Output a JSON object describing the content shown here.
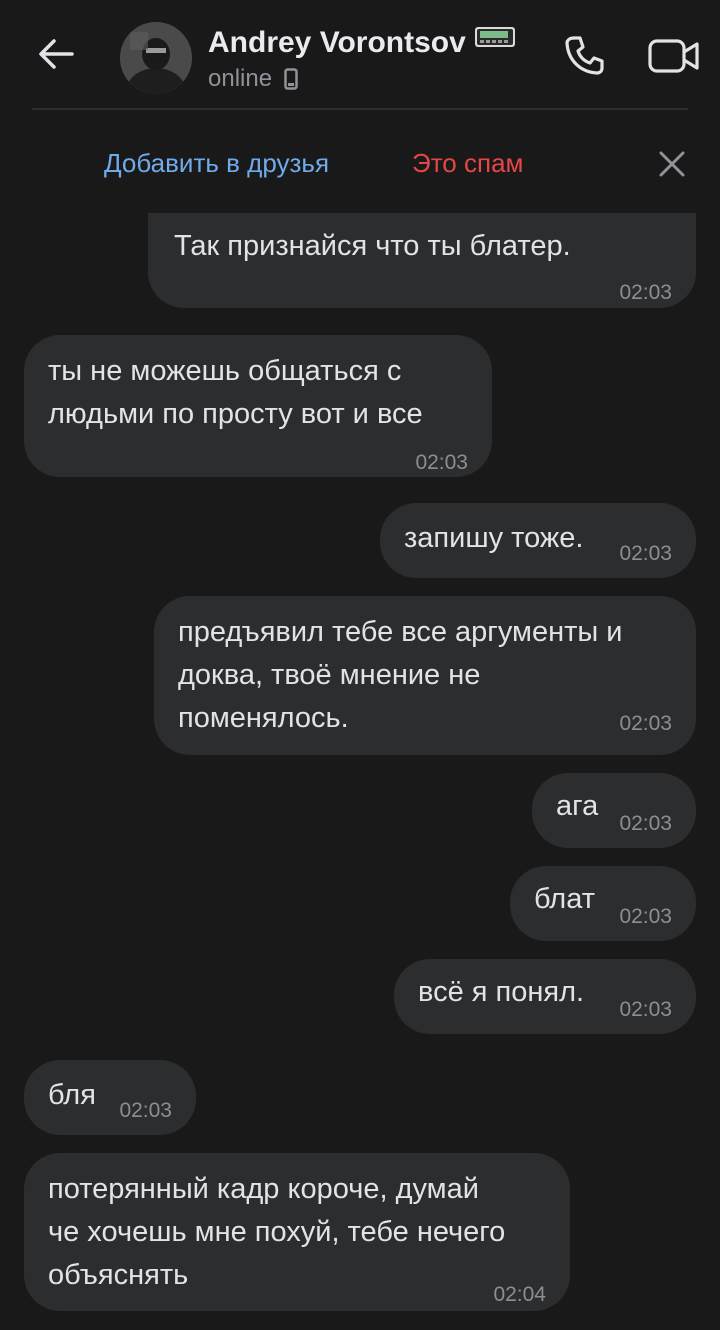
{
  "header": {
    "contact_name": "Andrey Vorontsov",
    "status": "online",
    "icons": {
      "back": "arrow-left-icon",
      "call": "phone-icon",
      "video": "video-camera-icon",
      "pager": "pager-icon",
      "device": "smartphone-icon"
    }
  },
  "friend_bar": {
    "add_friend_label": "Добавить в друзья",
    "spam_label": "Это спам",
    "close_icon": "close-icon"
  },
  "colors": {
    "background": "#19191a",
    "bubble": "#2c2d2e",
    "accent": "#71aaeb",
    "danger": "#e64646"
  },
  "messages": [
    {
      "text": "Так признайся что ты блатер.",
      "time": "02:03",
      "side": "out"
    },
    {
      "text": "ты не можешь общаться с\nлюдьми по просту вот и все",
      "time": "02:03",
      "side": "in"
    },
    {
      "text": "запишу тоже.",
      "time": "02:03",
      "side": "out"
    },
    {
      "text": "предъявил тебе все аргументы и\nдоква, твоё мнение не\nпоменялось.",
      "time": "02:03",
      "side": "out"
    },
    {
      "text": "ага",
      "time": "02:03",
      "side": "out"
    },
    {
      "text": "блат",
      "time": "02:03",
      "side": "out"
    },
    {
      "text": "всё я понял.",
      "time": "02:03",
      "side": "out"
    },
    {
      "text": "бля",
      "time": "02:03",
      "side": "in"
    },
    {
      "text": "потерянный кадр короче, думай\nче хочешь мне похуй, тебе нечего\nобъяснять",
      "time": "02:04",
      "side": "in"
    }
  ]
}
